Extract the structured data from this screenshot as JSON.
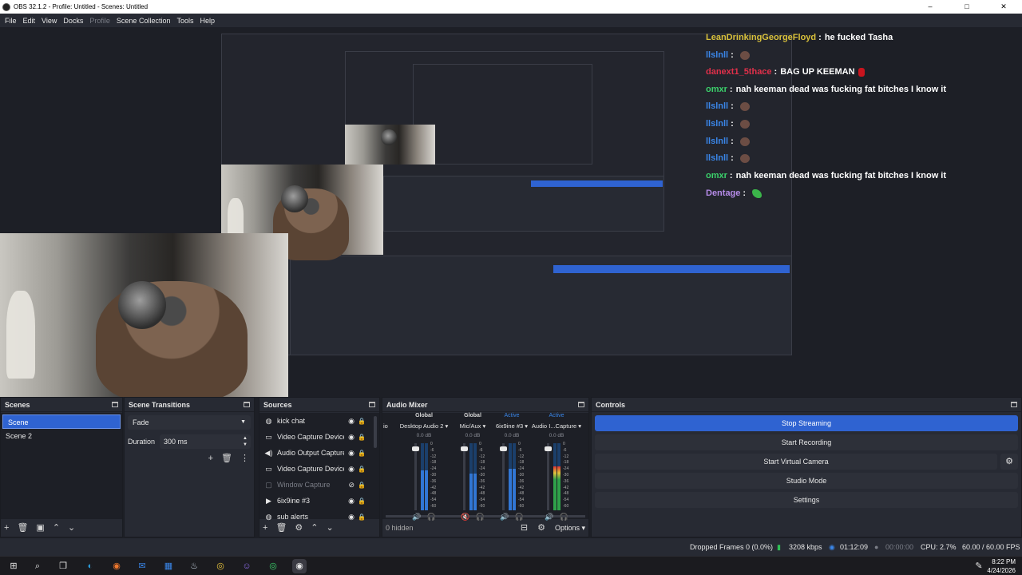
{
  "window": {
    "title": "OBS 32.1.2 - Profile: Untitled - Scenes: Untitled",
    "minimize": "–",
    "maximize": "□",
    "close": "✕"
  },
  "menu": [
    "File",
    "Edit",
    "View",
    "Docks",
    "Profile",
    "Scene Collection",
    "Tools",
    "Help"
  ],
  "chat": [
    {
      "user": "LeanDrinkingGeorgeFloyd",
      "user_color": "#d9c13b",
      "sep": ":",
      "msg": "he fucked Tasha",
      "emote": ""
    },
    {
      "user": "llslnll",
      "user_color": "#3a86e8",
      "sep": ":",
      "msg": "",
      "emote": "face"
    },
    {
      "user": "danext1_5thace",
      "user_color": "#e0304a",
      "sep": ":",
      "msg": "BAG UP KEEMAN",
      "emote": "red"
    },
    {
      "user": "omxr",
      "user_color": "#3bd16b",
      "sep": ":",
      "msg": "nah keeman dead was fucking fat bitches I know it",
      "emote": ""
    },
    {
      "user": "llslnll",
      "user_color": "#3a86e8",
      "sep": ":",
      "msg": "",
      "emote": "face"
    },
    {
      "user": "llslnll",
      "user_color": "#3a86e8",
      "sep": ":",
      "msg": "",
      "emote": "face"
    },
    {
      "user": "llslnll",
      "user_color": "#3a86e8",
      "sep": ":",
      "msg": "",
      "emote": "face"
    },
    {
      "user": "llslnll",
      "user_color": "#3a86e8",
      "sep": ":",
      "msg": "",
      "emote": "face"
    },
    {
      "user": "omxr",
      "user_color": "#3bd16b",
      "sep": ":",
      "msg": "nah keeman dead was fucking fat bitches I know it",
      "emote": ""
    },
    {
      "user": "Dentage",
      "user_color": "#b58be8",
      "sep": ":",
      "msg": "",
      "emote": "green"
    }
  ],
  "scenes": {
    "title": "Scenes",
    "items": [
      "Scene",
      "Scene 2"
    ],
    "selected": 0
  },
  "transitions": {
    "title": "Scene Transitions",
    "selected": "Fade",
    "duration_label": "Duration",
    "duration_value": "300 ms"
  },
  "sources": {
    "title": "Sources",
    "items": [
      {
        "name": "kick chat",
        "icon": "browser-icon",
        "dim": false
      },
      {
        "name": "Video Capture Device",
        "icon": "camera-icon",
        "dim": false
      },
      {
        "name": "Audio Output Capture",
        "icon": "speaker-icon",
        "dim": false
      },
      {
        "name": "Video Capture Device",
        "icon": "camera-icon",
        "dim": false
      },
      {
        "name": "Window Capture",
        "icon": "window-icon",
        "dim": true
      },
      {
        "name": "6ix9ine #3",
        "icon": "media-icon",
        "dim": false
      },
      {
        "name": "sub alerts",
        "icon": "browser-icon",
        "dim": false
      }
    ]
  },
  "mixer": {
    "title": "Audio Mixer",
    "headers": [
      "Global",
      "Global",
      "Active",
      "Active"
    ],
    "channels": [
      {
        "name": "Desktop Audio 2",
        "db": "0.0 dB",
        "level": 0.6,
        "fader": 0.95,
        "meter_color": "blue",
        "muted": false
      },
      {
        "name": "Mic/Aux",
        "db": "0.0 dB",
        "level": 0.55,
        "fader": 0.95,
        "meter_color": "blue",
        "muted": true
      },
      {
        "name": "6ix9ine #3",
        "db": "0.0 dB",
        "level": 0.62,
        "fader": 0.95,
        "meter_color": "blue",
        "muted": false
      },
      {
        "name": "Audio I...Capture",
        "db": "0.0 dB",
        "level": 0.65,
        "fader": 0.95,
        "meter_color": "green",
        "muted": false
      }
    ],
    "scale": [
      "0",
      "-6",
      "-12",
      "-18",
      "-24",
      "-30",
      "-36",
      "-42",
      "-48",
      "-54",
      "-60"
    ],
    "hidden_label": "0 hidden",
    "options_label": "Options",
    "partial_prefix": "io"
  },
  "controls": {
    "title": "Controls",
    "stop_streaming": "Stop Streaming",
    "start_recording": "Start Recording",
    "start_virtual_camera": "Start Virtual Camera",
    "studio_mode": "Studio Mode",
    "settings": "Settings"
  },
  "status": {
    "dropped_frames": "Dropped Frames 0 (0.0%)",
    "bitrate": "3208 kbps",
    "stream_time": "01:12:09",
    "record_time": "00:00:00",
    "cpu": "CPU: 2.7%",
    "fps": "60.00 / 60.00 FPS"
  },
  "taskbar": {
    "time": "8:22 PM",
    "date": "4/24/2026"
  },
  "colors": {
    "accent": "#2f63d1",
    "panel": "#272a33",
    "background": "#1d1f26"
  }
}
